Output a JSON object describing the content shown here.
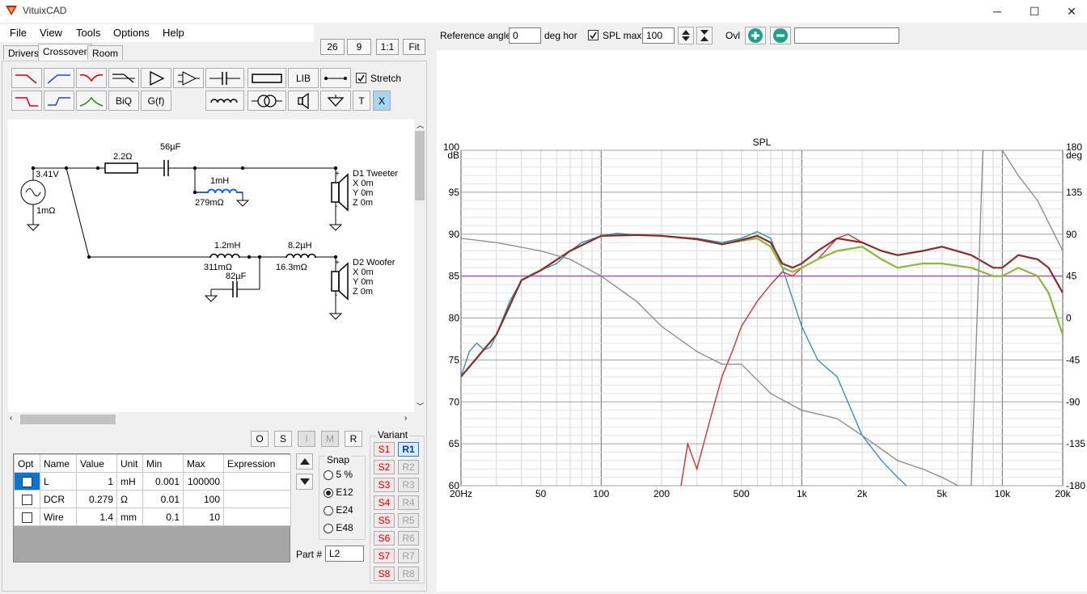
{
  "window": {
    "title": "VituixCAD",
    "minimize": "─",
    "maximize": "☐",
    "close": "✕"
  },
  "menu": [
    "File",
    "View",
    "Tools",
    "Options",
    "Help"
  ],
  "zoom": {
    "a": "26",
    "b": "9",
    "ratio": "1:1",
    "fit": "Fit"
  },
  "tabs": [
    "Drivers",
    "Crossover",
    "Room"
  ],
  "toolbar": {
    "lib": "LIB",
    "biq": "BiQ",
    "gf": "G(f)",
    "stretch": "Stretch",
    "t": "T",
    "x": "X"
  },
  "schematic": {
    "source_voltage": "3.41V",
    "source_impedance": "1mΩ",
    "r1": "2.2Ω",
    "c1": "56µF",
    "l1_value": "1mH",
    "l1_dcr": "279mΩ",
    "l2_value": "1.2mH",
    "l2_dcr": "311mΩ",
    "c2": "82µF",
    "l3_value": "8.2µH",
    "l3_dcr": "16.3mΩ",
    "d1": {
      "name": "D1 Tweeter",
      "x": "X 0m",
      "y": "Y 0m",
      "z": "Z 0m"
    },
    "d2": {
      "name": "D2 Woofer",
      "x": "X 0m",
      "y": "Y 0m",
      "z": "Z 0m"
    },
    "plus": "+",
    "minus": "-"
  },
  "osbuttons": [
    "O",
    "S",
    "I",
    "M",
    "R"
  ],
  "param_table": {
    "headers": [
      "Opt",
      "Name",
      "Value",
      "Unit",
      "Min",
      "Max",
      "Expression"
    ],
    "rows": [
      {
        "name": "L",
        "value": "1",
        "unit": "mH",
        "min": "0.001",
        "max": "100000"
      },
      {
        "name": "DCR",
        "value": "0.279",
        "unit": "Ω",
        "min": "0.01",
        "max": "100"
      },
      {
        "name": "Wire",
        "value": "1.4",
        "unit": "mm",
        "min": "0.1",
        "max": "10"
      }
    ]
  },
  "snap": {
    "title": "Snap",
    "options": [
      "5 %",
      "E12",
      "E24",
      "E48"
    ],
    "selected": "E12"
  },
  "part": {
    "label": "Part #",
    "value": "L2"
  },
  "variant": {
    "title": "Variant",
    "s": [
      "S1",
      "S2",
      "S3",
      "S4",
      "S5",
      "S6",
      "S7",
      "S8"
    ],
    "r": [
      "R1",
      "R2",
      "R3",
      "R4",
      "R5",
      "R6",
      "R7",
      "R8"
    ]
  },
  "right_toolbar": {
    "ref_angle_label": "Reference angle",
    "ref_angle_value": "0",
    "deg_hor": "deg hor",
    "spl_max_label": "SPL max",
    "spl_max_value": "100",
    "ovl": "Ovl"
  },
  "chart_data": {
    "type": "line",
    "title": "SPL",
    "x_scale": "log",
    "xlim": [
      20,
      20000
    ],
    "x_ticks": [
      "20Hz",
      "50",
      "100",
      "200",
      "500",
      "1k",
      "2k",
      "5k",
      "10k",
      "20k"
    ],
    "ylabel": "dB",
    "ylim": [
      60,
      100
    ],
    "y_ticks": [
      "100",
      "95",
      "90",
      "85",
      "80",
      "75",
      "70",
      "65",
      "60"
    ],
    "y2label": "deg",
    "y2lim": [
      -180,
      180
    ],
    "y2_ticks": [
      "180",
      "135",
      "90",
      "45",
      "0",
      "-45",
      "-90",
      "-135",
      "-180"
    ],
    "grid": true,
    "reference_line": {
      "value": 85,
      "color": "#cc33cc"
    },
    "series": [
      {
        "color": "#2a8ab8",
        "x": [
          20,
          22,
          24,
          26,
          28,
          30,
          35,
          40,
          45,
          50,
          60,
          70,
          80,
          100,
          120,
          150,
          200,
          300,
          400,
          500,
          600,
          700,
          800,
          1000,
          1200,
          1500,
          2000,
          2500,
          3000,
          3500,
          4000
        ],
        "y": [
          73,
          76,
          77,
          76.2,
          76.5,
          78,
          82,
          84.5,
          85.2,
          85.7,
          86.5,
          88,
          89,
          89.8,
          90.1,
          89.9,
          89.8,
          89.5,
          89,
          89.5,
          90.3,
          89.5,
          86,
          79,
          75,
          73,
          66,
          63,
          61,
          59.5,
          58
        ]
      },
      {
        "color": "#dd2020",
        "x": [
          250,
          270,
          300,
          350,
          400,
          450,
          500,
          600,
          700,
          800,
          900,
          1000,
          1200,
          1500,
          1700,
          2000,
          2500,
          3000
        ],
        "y": [
          60,
          65,
          62,
          68,
          73,
          76,
          79,
          82,
          84,
          85.5,
          85,
          86,
          87,
          89.5,
          90,
          89,
          88,
          87.5
        ]
      },
      {
        "color": "#88bb33",
        "x": [
          20,
          30,
          40,
          50,
          70,
          100,
          150,
          200,
          300,
          400,
          500,
          600,
          700,
          800,
          900,
          1000,
          1200,
          1500,
          2000,
          2500,
          3000,
          4000,
          5000,
          7000,
          9000,
          10000,
          12000,
          15000,
          17000,
          20000
        ],
        "y": [
          73,
          78,
          84.5,
          85.7,
          88,
          89.8,
          89.9,
          89.8,
          89.4,
          88.8,
          89.2,
          89.5,
          88.5,
          86,
          85.5,
          86,
          87,
          88,
          88.5,
          87,
          86,
          86.5,
          86.5,
          86,
          85,
          85,
          86,
          85,
          83,
          78
        ]
      },
      {
        "color": "#8b2c2c",
        "x": [
          20,
          30,
          40,
          50,
          70,
          100,
          150,
          200,
          300,
          400,
          500,
          600,
          700,
          800,
          900,
          1000,
          1200,
          1500,
          2000,
          2500,
          3000,
          4000,
          5000,
          7000,
          9000,
          10000,
          12000,
          15000,
          17000,
          20000
        ],
        "y": [
          73,
          78,
          84.5,
          85.7,
          88,
          89.8,
          89.9,
          89.8,
          89.4,
          88.8,
          89.3,
          89.8,
          89,
          86.5,
          86,
          86.5,
          88,
          89.5,
          89,
          88,
          87.5,
          88,
          88.5,
          87.5,
          86,
          86,
          87.5,
          87,
          86,
          83
        ]
      },
      {
        "color": "#888888",
        "x": [
          20,
          30,
          50,
          70,
          100,
          150,
          200,
          300,
          400,
          500,
          700,
          1000,
          1500,
          2000,
          3000,
          4000,
          5000,
          6000,
          7000,
          8000,
          10000,
          12000,
          15000,
          20000
        ],
        "y": [
          89.5,
          89,
          88,
          87,
          85,
          82,
          79,
          76,
          74.5,
          74.5,
          71,
          69,
          68,
          66,
          63,
          62,
          61,
          60,
          60,
          100,
          100,
          97,
          94,
          88
        ]
      }
    ]
  }
}
